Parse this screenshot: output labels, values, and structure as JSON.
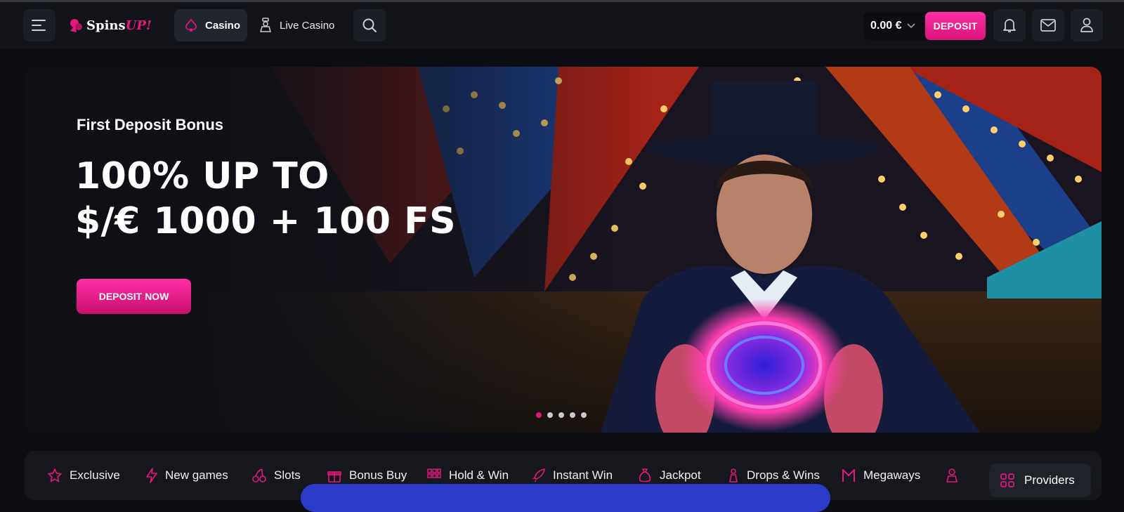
{
  "header": {
    "logo_word1": "Spins",
    "logo_word2": "UP!",
    "nav_casino": "Casino",
    "nav_live_casino": "Live Casino",
    "balance": "0.00 €",
    "deposit_label": "DEPOSIT"
  },
  "banner": {
    "subtitle": "First Deposit Bonus",
    "title_line1": "100% UP TO",
    "title_line2": "$/€ 1000 + 100 FS",
    "cta_label": "DEPOSIT NOW",
    "slides_count": 5,
    "active_slide": 1
  },
  "categories": [
    {
      "label": "Exclusive",
      "icon": "star-icon"
    },
    {
      "label": "New games",
      "icon": "lightning-icon"
    },
    {
      "label": "Slots",
      "icon": "cherry-icon"
    },
    {
      "label": "Bonus Buy",
      "icon": "gift-icon"
    },
    {
      "label": "Hold & Win",
      "icon": "grid-dots-icon"
    },
    {
      "label": "Instant Win",
      "icon": "rocket-icon"
    },
    {
      "label": "Jackpot",
      "icon": "money-bag-icon"
    },
    {
      "label": "Drops & Wins",
      "icon": "trophy-icon"
    },
    {
      "label": "Megaways",
      "icon": "m-icon"
    }
  ],
  "providers_label": "Providers",
  "colors": {
    "accent": "#e3177d",
    "background": "#0c0d12",
    "panel": "#16171d"
  }
}
